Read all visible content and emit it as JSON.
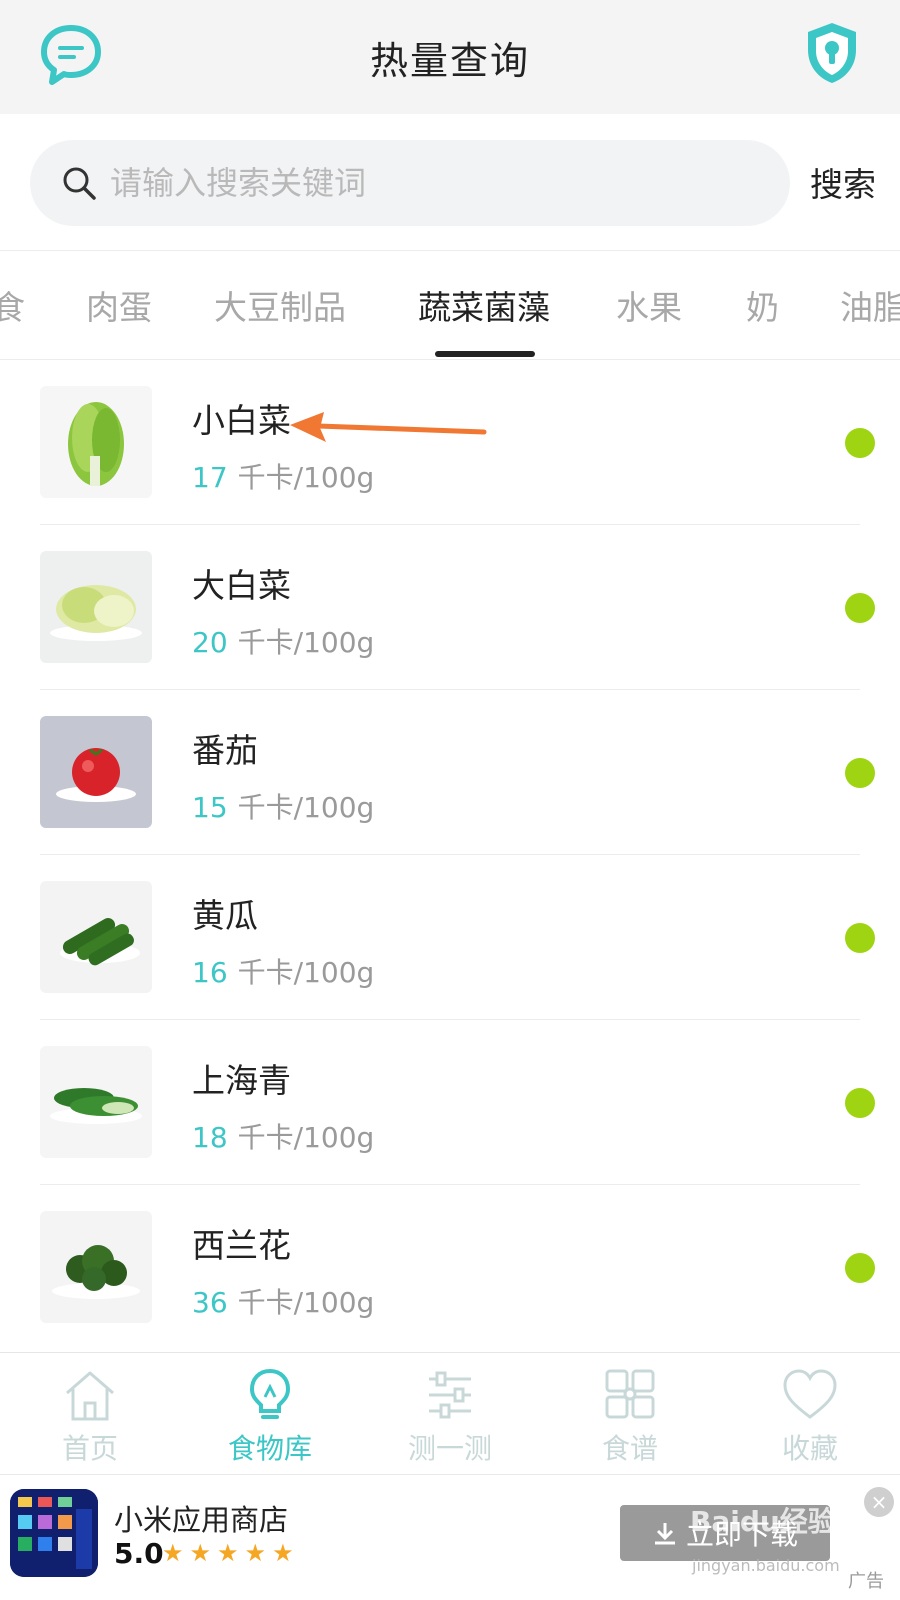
{
  "header": {
    "title": "热量查询",
    "chat_icon": "chat-bubble-icon",
    "shield_icon": "shield-lock-icon"
  },
  "search": {
    "placeholder": "请输入搜索关键词",
    "button_label": "搜索"
  },
  "tabs": [
    {
      "label": "食"
    },
    {
      "label": "肉蛋"
    },
    {
      "label": "大豆制品"
    },
    {
      "label": "蔬菜菌藻",
      "active": true
    },
    {
      "label": "水果"
    },
    {
      "label": "奶"
    },
    {
      "label": "油脂"
    }
  ],
  "foods": [
    {
      "name": "小白菜",
      "kcal": "17",
      "unit": "千卡/100g"
    },
    {
      "name": "大白菜",
      "kcal": "20",
      "unit": "千卡/100g"
    },
    {
      "name": "番茄",
      "kcal": "15",
      "unit": "千卡/100g"
    },
    {
      "name": "黄瓜",
      "kcal": "16",
      "unit": "千卡/100g"
    },
    {
      "name": "上海青",
      "kcal": "18",
      "unit": "千卡/100g"
    },
    {
      "name": "西兰花",
      "kcal": "36",
      "unit": "千卡/100g"
    }
  ],
  "nav": [
    {
      "label": "首页",
      "icon": "home-icon"
    },
    {
      "label": "食物库",
      "icon": "lightbulb-icon",
      "active": true
    },
    {
      "label": "测一测",
      "icon": "sliders-icon"
    },
    {
      "label": "食谱",
      "icon": "grid-icon"
    },
    {
      "label": "收藏",
      "icon": "heart-icon"
    }
  ],
  "ad": {
    "title": "小米应用商店",
    "rating": "5.0",
    "stars": "★★★★★",
    "download_label": "立即下载",
    "close": "×",
    "tag": "广告"
  },
  "watermark": {
    "text": "Baidu经验",
    "sub": "jingyan.baidu.com"
  },
  "colors": {
    "accent": "#3cc6c6",
    "dot": "#9ed411",
    "arrow": "#f07833"
  }
}
